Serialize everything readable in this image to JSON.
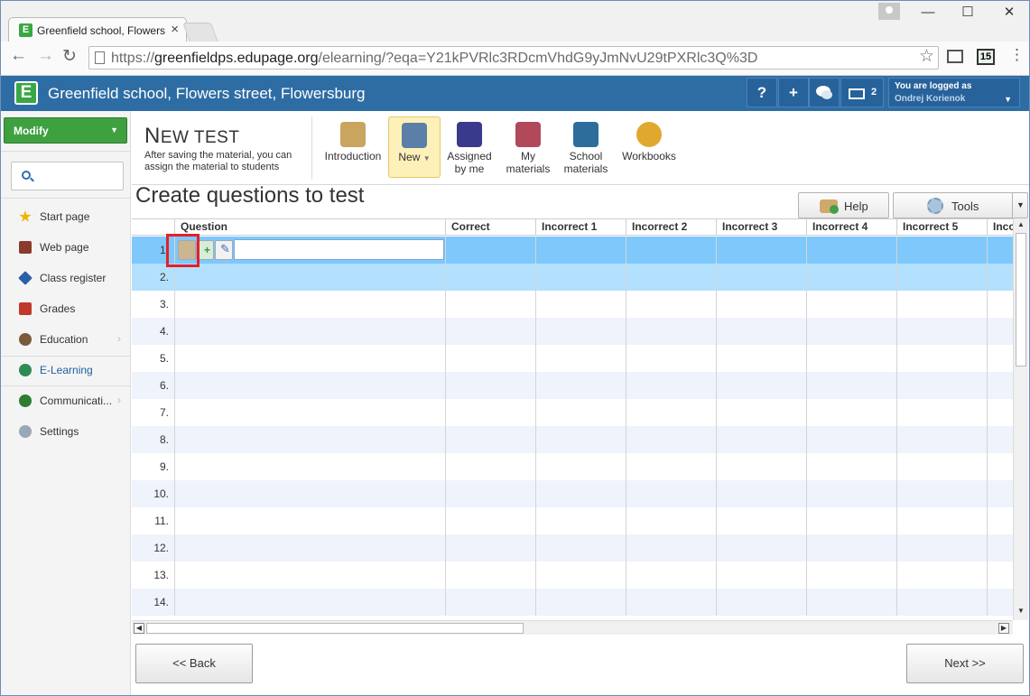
{
  "browser": {
    "tab_title": "Greenfield school, Flowers",
    "tab_favicon": "E",
    "url_scheme": "https://",
    "url_host": "greenfieldps.edupage.org",
    "url_path": "/elearning/?eqa=Y21kPVRlc3RDcmVhdG9yJmNvU29tPXRlc3Q%3D",
    "calendar_badge": "15"
  },
  "header": {
    "logo": "E",
    "school_name": "Greenfield school, Flowers street, Flowersburg",
    "help_label": "?",
    "add_label": "+",
    "message_count": "2",
    "logged_caption": "You are logged as",
    "user_name": "Ondrej Korienok"
  },
  "sidebar": {
    "modify_label": "Modify",
    "search_placeholder": "",
    "items": [
      {
        "label": "Start page",
        "icon": "star-icon",
        "color": "#f0b400"
      },
      {
        "label": "Web page",
        "icon": "web-icon",
        "color": "#8b3b2b"
      },
      {
        "label": "Class register",
        "icon": "class-register-icon",
        "color": "#2c5fa8"
      },
      {
        "label": "Grades",
        "icon": "grades-icon",
        "color": "#c0392b"
      },
      {
        "label": "Education",
        "icon": "education-icon",
        "color": "#7a5a3a"
      },
      {
        "label": "E-Learning",
        "icon": "globe-icon",
        "color": "#2e8b57"
      },
      {
        "label": "Communicati...",
        "icon": "communication-icon",
        "color": "#2e7d32"
      },
      {
        "label": "Settings",
        "icon": "gear-icon",
        "color": "#9aa7b5"
      }
    ]
  },
  "toolbar": {
    "title_first": "N",
    "title_rest": "EW TEST",
    "description": "After saving the material, you can assign the material to students",
    "buttons": [
      {
        "label": "Introduction",
        "icon": "introduction-icon"
      },
      {
        "label": "New",
        "icon": "new-icon"
      },
      {
        "label": "Assigned by me",
        "icon": "assigned-icon"
      },
      {
        "label": "My materials",
        "icon": "my-materials-icon"
      },
      {
        "label": "School materials",
        "icon": "school-materials-icon"
      },
      {
        "label": "Workbooks",
        "icon": "workbooks-icon"
      }
    ]
  },
  "main": {
    "section_title": "Create questions to test",
    "help_label": "Help",
    "tools_label": "Tools",
    "columns": [
      "Question",
      "Correct",
      "Incorrect 1",
      "Incorrect 2",
      "Incorrect 3",
      "Incorrect 4",
      "Incorrect 5",
      "Inco"
    ],
    "rows": [
      "1.",
      "2.",
      "3.",
      "4.",
      "5.",
      "6.",
      "7.",
      "8.",
      "9.",
      "10.",
      "11.",
      "12.",
      "13.",
      "14."
    ],
    "first_row_value": ""
  },
  "footer": {
    "back_label": "<< Back",
    "next_label": "Next >>"
  },
  "colors": {
    "header_bg": "#2e6da4",
    "modify_bg": "#3fa040",
    "row_selected": "#7ec8fb",
    "row_secondary": "#b3e0fd",
    "row_alt": "#eef3fc",
    "highlight": "#e4202a"
  }
}
